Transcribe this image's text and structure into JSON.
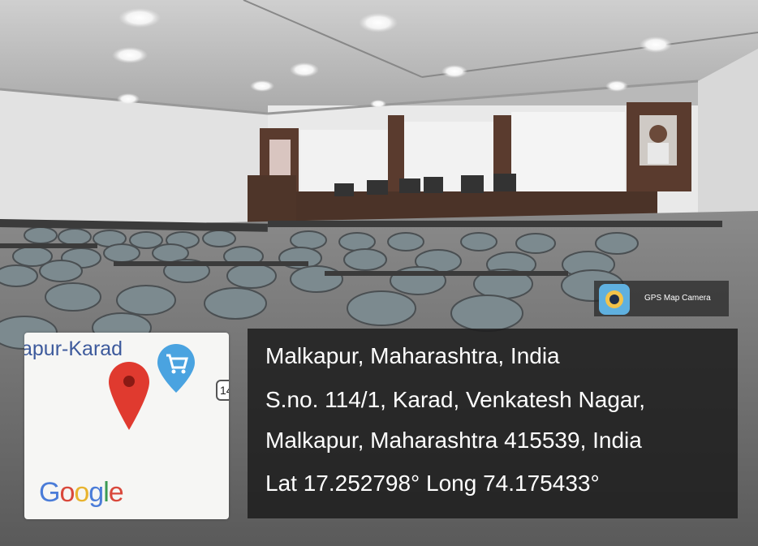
{
  "map": {
    "place_label": "apur-Karad",
    "road_marker": "14",
    "provider_logo": [
      "G",
      "o",
      "o",
      "g",
      "l",
      "e"
    ]
  },
  "badge": {
    "app_name": "GPS Map Camera",
    "icon": "gps-map-camera-app-icon"
  },
  "location": {
    "title": "Malkapur, Maharashtra, India",
    "address_line1": "S.no. 114/1, Karad, Venkatesh Nagar,",
    "address_line2": "Malkapur, Maharashtra 415539, India",
    "coordinates": "Lat 17.252798° Long 74.175433°"
  },
  "icons": {
    "map_pin": "map-pin-icon",
    "shopping": "shopping-cart-marker-icon"
  }
}
